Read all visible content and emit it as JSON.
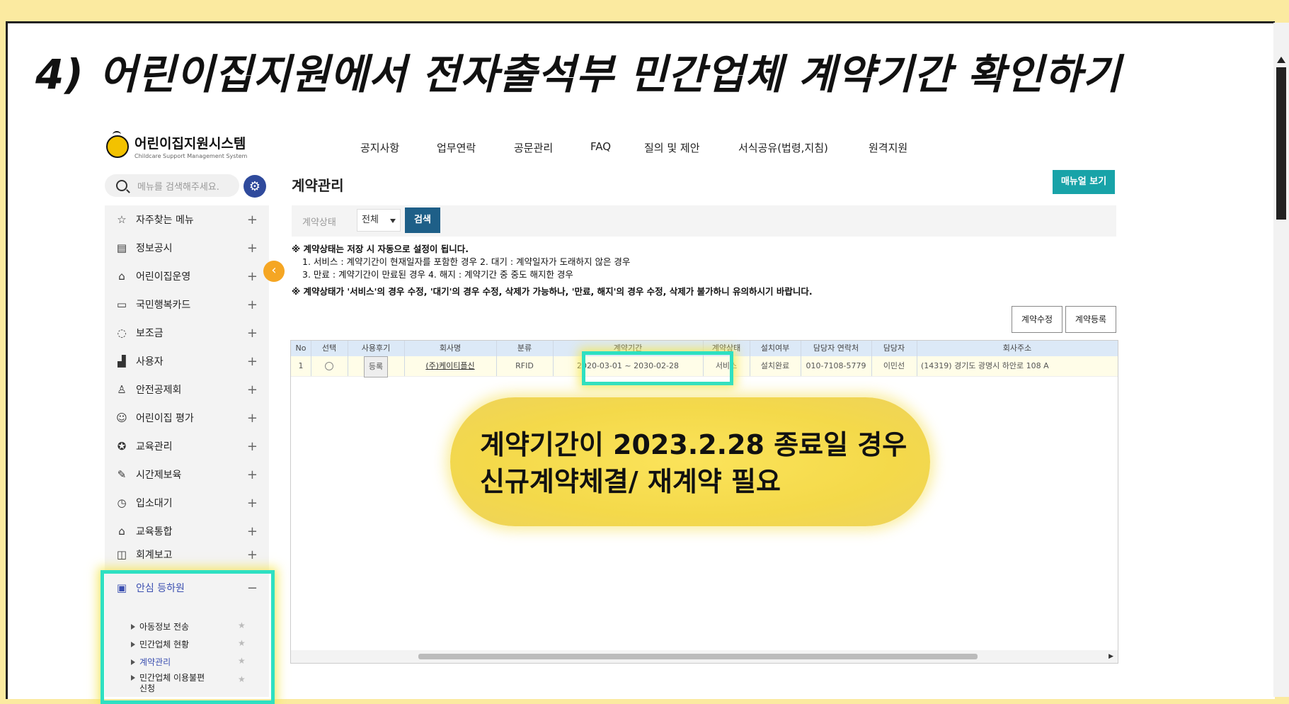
{
  "slide": {
    "title": "4) 어린이집지원에서 전자출석부 민간업체 계약기간 확인하기"
  },
  "header": {
    "logo_title": "어린이집지원시스템",
    "logo_subtitle": "Childcare Support Management System",
    "nav": [
      "공지사항",
      "업무연락",
      "공문관리",
      "FAQ",
      "질의 및 제안",
      "서식공유(법령,지침)",
      "원격지원"
    ]
  },
  "sidebar": {
    "search_placeholder": "메뉴를 검색해주세요.",
    "items": [
      {
        "label": "자주찾는 메뉴",
        "icon": "star-icon"
      },
      {
        "label": "정보공시",
        "icon": "document-icon"
      },
      {
        "label": "어린이집운영",
        "icon": "house-icon"
      },
      {
        "label": "국민행복카드",
        "icon": "card-icon"
      },
      {
        "label": "보조금",
        "icon": "chat-icon"
      },
      {
        "label": "사용자",
        "icon": "bar-chart-icon"
      },
      {
        "label": "안전공제회",
        "icon": "person-icon"
      },
      {
        "label": "어린이집 평가",
        "icon": "smile-icon"
      },
      {
        "label": "교육관리",
        "icon": "badge-icon"
      },
      {
        "label": "시간제보육",
        "icon": "pen-icon"
      },
      {
        "label": "입소대기",
        "icon": "clock-icon"
      },
      {
        "label": "교육통합",
        "icon": "home-stack-icon"
      },
      {
        "label": "회계보고",
        "icon": "book-icon"
      }
    ],
    "expanded": {
      "label": "안심 등하원",
      "icon": "calendar-icon",
      "subitems": [
        "아동정보 전송",
        "민간업체 현황",
        "계약관리",
        "민간업체 이용불편",
        "신청"
      ]
    }
  },
  "main": {
    "title": "계약관리",
    "manual_button": "매뉴얼 보기",
    "filter": {
      "label": "계약상태",
      "selected": "전체",
      "search_button": "검색"
    },
    "notes": [
      "※ 계약상태는 저장 시 자동으로 설정이 됩니다.",
      "1. 서비스 : 계약기간이 현재일자를 포함한 경우 2. 대기 : 계약일자가 도래하지 않은 경우",
      "3. 만료 : 계약기간이 만료된 경우 4. 해지 : 계약기간 중 중도 해지한 경우",
      "※ 계약상태가 '서비스'의 경우 수정, '대기'의 경우 수정, 삭제가 가능하나, '만료, 해지'의 경우 수정, 삭제가 불가하니 유의하시기 바랍니다."
    ],
    "edit_button": "계약수정",
    "register_button": "계약등록",
    "table": {
      "columns": [
        "No",
        "선택",
        "사용후기",
        "회사명",
        "분류",
        "계약기간",
        "계약상태",
        "설치여부",
        "담당자 연락처",
        "담당자",
        "회사주소"
      ],
      "rows": [
        {
          "no": "1",
          "review_button": "등록",
          "company": "(주)케이티플신",
          "type": "RFID",
          "period": "2020-03-01 ~ 2030-02-28",
          "status": "서비스",
          "install": "설치완료",
          "phone": "010-7108-5779",
          "manager": "이민선",
          "address": "(14319) 경기도 광명시 하안로 108 A"
        }
      ]
    }
  },
  "callout": {
    "line1": "계약기간이 2023.2.28 종료일 경우",
    "line2": "신규계약체결/ 재계약 필요"
  },
  "colors": {
    "slide_border": "#fbeaa0",
    "highlight": "#2ee0c2",
    "callout": "#f4d94a",
    "manual_button": "#18a3a8",
    "search_button": "#1e5f88"
  }
}
